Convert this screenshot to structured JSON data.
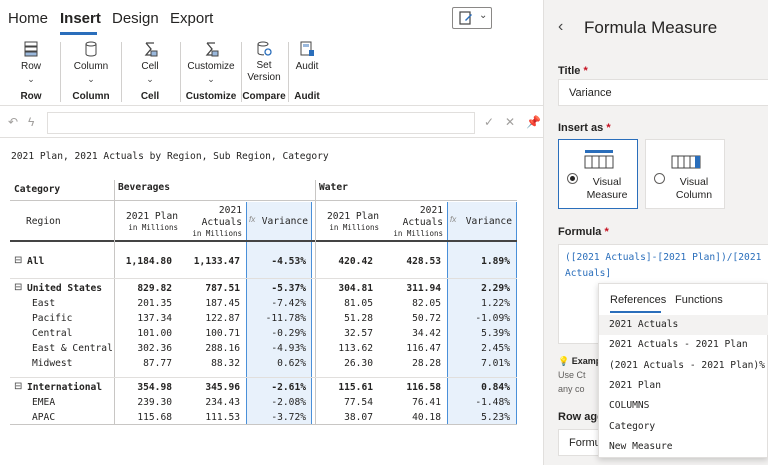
{
  "tabs": [
    "Home",
    "Insert",
    "Design",
    "Export"
  ],
  "ribbon": {
    "buttons": [
      {
        "label": "Row",
        "icon": "row-stack-icon"
      },
      {
        "label": "Column",
        "icon": "column-cylinder-icon"
      },
      {
        "label": "Cell",
        "icon": "sigma-icon"
      },
      {
        "label": "Customize",
        "icon": "sigma-icon"
      },
      {
        "label": "Set",
        "label2": "Version",
        "icon": "version-gear-icon"
      },
      {
        "label": "Audit",
        "icon": "calculator-icon"
      }
    ],
    "groups": [
      "Row",
      "Column",
      "Cell",
      "Customize",
      "Compare",
      "Audit"
    ]
  },
  "report": {
    "subtitle": "2021 Plan, 2021 Actuals by Region, Sub Region, Category"
  },
  "table": {
    "category_header": "Category",
    "region_header": "Region",
    "groups": [
      "Beverages",
      "Water"
    ],
    "col_plan": "2021 Plan",
    "col_plan_unit": "in Millions",
    "col_actuals_1": "2021",
    "col_actuals_2": "Actuals",
    "col_actuals_unit": "in Millions",
    "col_fx": "fx",
    "col_variance": "Variance",
    "rows": [
      {
        "label": "All",
        "bold": true,
        "expand": "⊟",
        "indent": 0,
        "values": [
          "1,184.80",
          "1,133.47",
          "-4.53%",
          "420.42",
          "428.53",
          "1.89%"
        ]
      },
      {
        "label": "United States",
        "bold": true,
        "expand": "⊟",
        "indent": 0,
        "values": [
          "829.82",
          "787.51",
          "-5.37%",
          "304.81",
          "311.94",
          "2.29%"
        ]
      },
      {
        "label": "East",
        "bold": false,
        "expand": "",
        "indent": 1,
        "values": [
          "201.35",
          "187.45",
          "-7.42%",
          "81.05",
          "82.05",
          "1.22%"
        ]
      },
      {
        "label": "Pacific",
        "bold": false,
        "expand": "",
        "indent": 1,
        "values": [
          "137.34",
          "122.87",
          "-11.78%",
          "51.28",
          "50.72",
          "-1.09%"
        ]
      },
      {
        "label": "Central",
        "bold": false,
        "expand": "",
        "indent": 1,
        "values": [
          "101.00",
          "100.71",
          "-0.29%",
          "32.57",
          "34.42",
          "5.39%"
        ]
      },
      {
        "label": "East & Central",
        "bold": false,
        "expand": "",
        "indent": 1,
        "values": [
          "302.36",
          "288.16",
          "-4.93%",
          "113.62",
          "116.47",
          "2.45%"
        ]
      },
      {
        "label": "Midwest",
        "bold": false,
        "expand": "",
        "indent": 1,
        "values": [
          "87.77",
          "88.32",
          "0.62%",
          "26.30",
          "28.28",
          "7.01%"
        ]
      },
      {
        "label": "International",
        "bold": true,
        "expand": "⊟",
        "indent": 0,
        "values": [
          "354.98",
          "345.96",
          "-2.61%",
          "115.61",
          "116.58",
          "0.84%"
        ]
      },
      {
        "label": "EMEA",
        "bold": false,
        "expand": "",
        "indent": 1,
        "values": [
          "239.30",
          "234.43",
          "-2.08%",
          "77.54",
          "76.41",
          "-1.48%"
        ]
      },
      {
        "label": "APAC",
        "bold": false,
        "expand": "",
        "indent": 1,
        "values": [
          "115.68",
          "111.53",
          "-3.72%",
          "38.07",
          "40.18",
          "5.23%"
        ]
      }
    ]
  },
  "panel": {
    "title": "Formula Measure",
    "title_label": "Title",
    "title_value": "Variance",
    "insert_as_label": "Insert as",
    "visual_measure_1": "Visual",
    "visual_measure_2": "Measure",
    "visual_column_1": "Visual",
    "visual_column_2": "Column",
    "formula_label": "Formula",
    "formula_text": "([2021 Actuals]-[2021 Plan])/[2021 Actuals]",
    "hint_1": "Examp",
    "hint_2": "Use Ct",
    "hint_3": "any co",
    "row_agg_label": "Row agg",
    "row_agg_value": "Formul"
  },
  "dropdown": {
    "tabs": [
      "References",
      "Functions"
    ],
    "items": [
      "2021 Actuals",
      "2021 Actuals - 2021 Plan",
      "(2021 Actuals - 2021 Plan)%",
      "2021 Plan",
      "COLUMNS",
      "Category",
      "New Measure"
    ]
  },
  "colors": {
    "accent": "#2a6ebb",
    "variance_bg": "#e8f1fb",
    "panel_bg": "#f3f2f1"
  }
}
